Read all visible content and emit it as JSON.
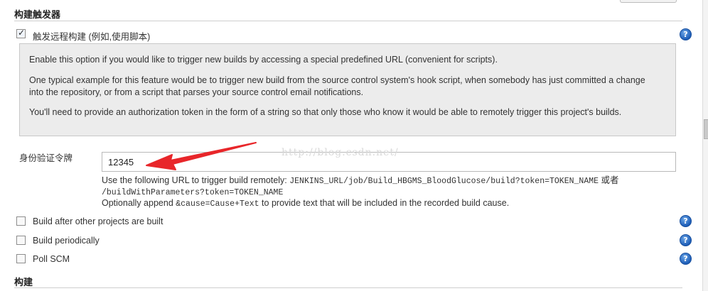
{
  "triggers_section": {
    "title": "构建触发器"
  },
  "remote_trigger": {
    "checkbox_label": "触发远程构建 (例如,使用脚本)",
    "checked": true,
    "help": {
      "p1": "Enable this option if you would like to trigger new builds by accessing a special predefined URL (convenient for scripts).",
      "p2": "One typical example for this feature would be to trigger new build from the source control system's hook script, when somebody has just committed a change into the repository, or from a script that parses your source control email notifications.",
      "p3": "You'll need to provide an authorization token in the form of a string so that only those who know it would be able to remotely trigger this project's builds."
    },
    "token_label": "身份验证令牌",
    "token_value": "12345",
    "url_desc": {
      "line1_prefix": "Use the following URL to trigger build remotely: ",
      "line1_code": "JENKINS_URL/job/Build_HBGMS_BloodGlucose/build?token=TOKEN_NAME",
      "line1_suffix": " 或者",
      "line2_code": "/buildWithParameters?token=TOKEN_NAME",
      "line3_prefix": "Optionally append ",
      "line3_code": "&cause=Cause+Text",
      "line3_suffix": " to provide text that will be included in the recorded build cause."
    }
  },
  "other_triggers": [
    {
      "label": "Build after other projects are built",
      "checked": false
    },
    {
      "label": "Build periodically",
      "checked": false
    },
    {
      "label": "Poll SCM",
      "checked": false
    }
  ],
  "build_section": {
    "title": "构建"
  },
  "watermark": "http://blog.csdn.net/",
  "help_glyph": "?",
  "colors": {
    "help_icon": "#1d5db7",
    "annotation_arrow": "#e8262a",
    "help_box_bg": "#ececec"
  },
  "icons": {
    "help": "help-question-icon",
    "check": "checkmark-icon",
    "arrow": "red-arrow-annotation"
  }
}
